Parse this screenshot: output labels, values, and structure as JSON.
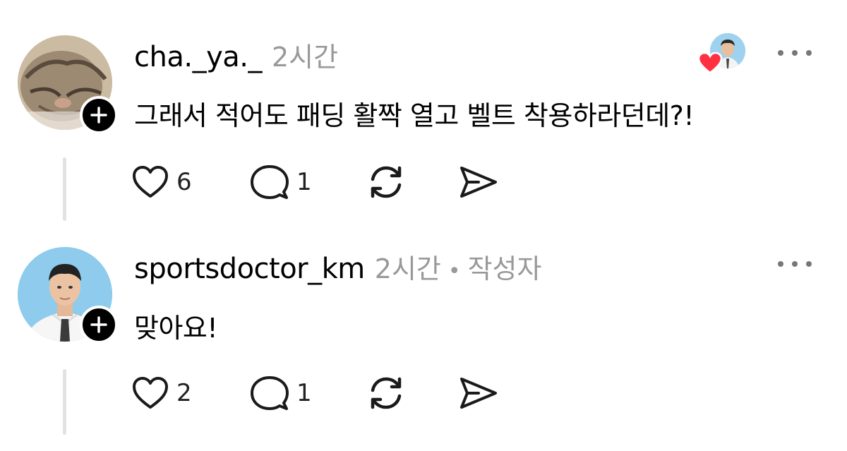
{
  "comments": [
    {
      "username": "cha._ya._",
      "time": "2시간",
      "text": "그래서 적어도 패딩 활짝 열고 벨트 착용하라던데?!",
      "like_count": "6",
      "reply_count": "1",
      "liked_by_author": true,
      "avatar": "cat-photo"
    },
    {
      "username": "sportsdoctor_km",
      "time": "2시간",
      "separator": "•",
      "author_tag": "작성자",
      "text": "맞아요!",
      "like_count": "2",
      "reply_count": "1",
      "avatar": "man-in-white-shirt-photo"
    }
  ],
  "icons": {
    "like": "heart-outline-icon",
    "reply": "speech-bubble-icon",
    "repost": "repost-arrows-icon",
    "share": "paper-plane-icon",
    "more": "more-dots-icon",
    "follow": "plus-icon",
    "author_like": "red-heart-icon"
  },
  "colors": {
    "heart_red": "#ff3040",
    "muted_text": "#999999",
    "icon": "#1a1a1a"
  }
}
